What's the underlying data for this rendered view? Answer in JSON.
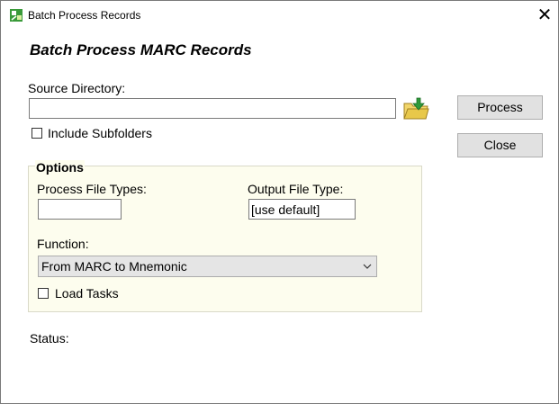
{
  "window": {
    "title": "Batch Process Records",
    "close_glyph": "✕"
  },
  "heading": "Batch Process MARC Records",
  "source": {
    "label": "Source Directory:",
    "value": "",
    "browse_icon": "folder-open-icon",
    "include_subfolders_label": "Include Subfolders",
    "include_subfolders_checked": false
  },
  "buttons": {
    "process": "Process",
    "close": "Close"
  },
  "options": {
    "legend": "Options",
    "process_file_types_label": "Process File Types:",
    "process_file_types_value": "",
    "output_file_type_label": "Output File Type:",
    "output_file_type_value": "[use default]",
    "function_label": "Function:",
    "function_value": "From MARC to Mnemonic",
    "load_tasks_label": "Load Tasks",
    "load_tasks_checked": false
  },
  "status": {
    "label": "Status:",
    "value": ""
  },
  "colors": {
    "options_bg": "#fdfdee",
    "button_bg": "#e1e1e1",
    "folder_icon": "#e8c84a",
    "arrow_icon": "#2e9a3a"
  }
}
